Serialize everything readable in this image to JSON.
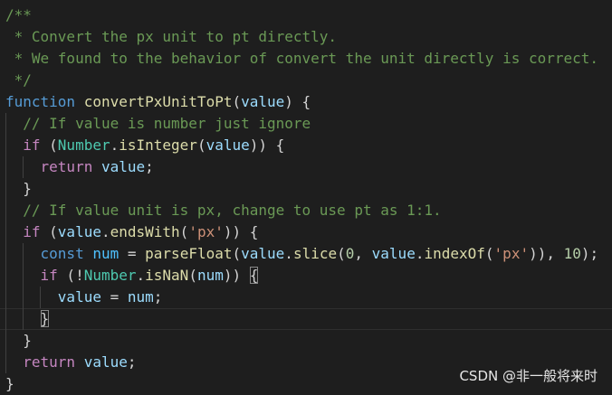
{
  "watermark": "CSDN @非一般将来时",
  "colors": {
    "background": "#1e1e1e",
    "comment": "#6a9955",
    "keyword": "#569cd6",
    "control": "#c586c0",
    "function": "#dcdcaa",
    "variable": "#9cdcfe",
    "class": "#4ec9b0",
    "string": "#ce9178",
    "number": "#b5cea8",
    "plain": "#d4d4d4"
  },
  "code": {
    "lines": [
      [
        {
          "t": "/**",
          "c": "comment"
        }
      ],
      [
        {
          "t": " * Convert the px unit to pt directly.",
          "c": "comment"
        }
      ],
      [
        {
          "t": " * We found to the behavior of convert the unit directly is correct.",
          "c": "comment"
        }
      ],
      [
        {
          "t": " */",
          "c": "comment"
        }
      ],
      [
        {
          "t": "function",
          "c": "keyword"
        },
        {
          "t": " ",
          "c": "plain"
        },
        {
          "t": "convertPxUnitToPt",
          "c": "func"
        },
        {
          "t": "(",
          "c": "plain"
        },
        {
          "t": "value",
          "c": "var"
        },
        {
          "t": ") {",
          "c": "plain"
        }
      ],
      [
        {
          "t": "  ",
          "c": "plain"
        },
        {
          "t": "// If value is number just ignore",
          "c": "comment"
        }
      ],
      [
        {
          "t": "  ",
          "c": "plain"
        },
        {
          "t": "if",
          "c": "control"
        },
        {
          "t": " (",
          "c": "plain"
        },
        {
          "t": "Number",
          "c": "class"
        },
        {
          "t": ".",
          "c": "plain"
        },
        {
          "t": "isInteger",
          "c": "func"
        },
        {
          "t": "(",
          "c": "plain"
        },
        {
          "t": "value",
          "c": "var"
        },
        {
          "t": ")) {",
          "c": "plain"
        }
      ],
      [
        {
          "t": "    ",
          "c": "plain"
        },
        {
          "t": "return",
          "c": "control"
        },
        {
          "t": " ",
          "c": "plain"
        },
        {
          "t": "value",
          "c": "var"
        },
        {
          "t": ";",
          "c": "plain"
        }
      ],
      [
        {
          "t": "  }",
          "c": "plain"
        }
      ],
      [
        {
          "t": "  ",
          "c": "plain"
        },
        {
          "t": "// If value unit is px, change to use pt as 1:1.",
          "c": "comment"
        }
      ],
      [
        {
          "t": "  ",
          "c": "plain"
        },
        {
          "t": "if",
          "c": "control"
        },
        {
          "t": " (",
          "c": "plain"
        },
        {
          "t": "value",
          "c": "var"
        },
        {
          "t": ".",
          "c": "plain"
        },
        {
          "t": "endsWith",
          "c": "func"
        },
        {
          "t": "(",
          "c": "plain"
        },
        {
          "t": "'px'",
          "c": "string"
        },
        {
          "t": ")) {",
          "c": "plain"
        }
      ],
      [
        {
          "t": "    ",
          "c": "plain"
        },
        {
          "t": "const",
          "c": "keyword"
        },
        {
          "t": " ",
          "c": "plain"
        },
        {
          "t": "num",
          "c": "const"
        },
        {
          "t": " = ",
          "c": "plain"
        },
        {
          "t": "parseFloat",
          "c": "func"
        },
        {
          "t": "(",
          "c": "plain"
        },
        {
          "t": "value",
          "c": "var"
        },
        {
          "t": ".",
          "c": "plain"
        },
        {
          "t": "slice",
          "c": "func"
        },
        {
          "t": "(",
          "c": "plain"
        },
        {
          "t": "0",
          "c": "number"
        },
        {
          "t": ", ",
          "c": "plain"
        },
        {
          "t": "value",
          "c": "var"
        },
        {
          "t": ".",
          "c": "plain"
        },
        {
          "t": "indexOf",
          "c": "func"
        },
        {
          "t": "(",
          "c": "plain"
        },
        {
          "t": "'px'",
          "c": "string"
        },
        {
          "t": ")), ",
          "c": "plain"
        },
        {
          "t": "10",
          "c": "number"
        },
        {
          "t": ");",
          "c": "plain"
        }
      ],
      [
        {
          "t": "    ",
          "c": "plain"
        },
        {
          "t": "if",
          "c": "control"
        },
        {
          "t": " (!",
          "c": "plain"
        },
        {
          "t": "Number",
          "c": "class"
        },
        {
          "t": ".",
          "c": "plain"
        },
        {
          "t": "isNaN",
          "c": "func"
        },
        {
          "t": "(",
          "c": "plain"
        },
        {
          "t": "num",
          "c": "var"
        },
        {
          "t": ")) ",
          "c": "plain"
        },
        {
          "t": "{",
          "c": "plain",
          "m": 1
        }
      ],
      [
        {
          "t": "      ",
          "c": "plain"
        },
        {
          "t": "value",
          "c": "var"
        },
        {
          "t": " = ",
          "c": "plain"
        },
        {
          "t": "num",
          "c": "var"
        },
        {
          "t": ";",
          "c": "plain"
        }
      ],
      [
        {
          "t": "    ",
          "c": "plain"
        },
        {
          "t": "}",
          "c": "plain",
          "m": 1
        }
      ],
      [
        {
          "t": "  }",
          "c": "plain"
        }
      ],
      [
        {
          "t": "  ",
          "c": "plain"
        },
        {
          "t": "return",
          "c": "control"
        },
        {
          "t": " ",
          "c": "plain"
        },
        {
          "t": "value",
          "c": "var"
        },
        {
          "t": ";",
          "c": "plain"
        }
      ],
      [
        {
          "t": "}",
          "c": "plain"
        }
      ]
    ]
  }
}
